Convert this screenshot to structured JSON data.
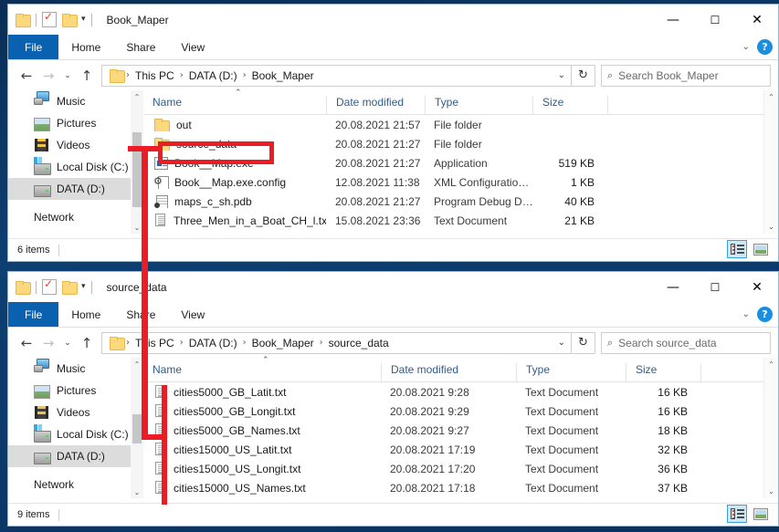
{
  "windows": [
    {
      "id": "window-book-maper",
      "title": "Book_Maper",
      "tabs": [
        "File",
        "Home",
        "Share",
        "View"
      ],
      "help_label": "?",
      "nav": {
        "back": "←",
        "forward": "→",
        "recent": "⌄",
        "up": "↑",
        "refresh": "↻",
        "crumbs": [
          "This PC",
          "DATA (D:)",
          "Book_Maper"
        ],
        "crumb_sep": "›",
        "dropdown_caret": "⌄",
        "search_placeholder": "Search Book_Maper",
        "search_icon": "⌕"
      },
      "sidebar": [
        {
          "label": "Music",
          "icon": "music-icon",
          "selected": false
        },
        {
          "label": "Pictures",
          "icon": "pictures-icon",
          "selected": false
        },
        {
          "label": "Videos",
          "icon": "videos-icon",
          "selected": false
        },
        {
          "label": "Local Disk (C:)",
          "icon": "drive-c-icon",
          "selected": false
        },
        {
          "label": "DATA (D:)",
          "icon": "drive-d-icon",
          "selected": true
        },
        {
          "label": "Network",
          "icon": "network-icon",
          "selected": false
        }
      ],
      "columns": [
        "Name",
        "Date modified",
        "Type",
        "Size"
      ],
      "sort_indicator": "⌃",
      "rows": [
        {
          "name": "out",
          "icon": "folder-icon",
          "date": "20.08.2021 21:57",
          "type": "File folder",
          "size": ""
        },
        {
          "name": "source_data",
          "icon": "folder-icon",
          "date": "20.08.2021 21:27",
          "type": "File folder",
          "size": ""
        },
        {
          "name": "Book__Map.exe",
          "icon": "exe-icon",
          "date": "20.08.2021 21:27",
          "type": "Application",
          "size": "519 KB"
        },
        {
          "name": "Book__Map.exe.config",
          "icon": "config-icon",
          "date": "12.08.2021 11:38",
          "type": "XML Configuratio…",
          "size": "1 KB"
        },
        {
          "name": "maps_c_sh.pdb",
          "icon": "pdb-icon",
          "date": "20.08.2021 21:27",
          "type": "Program Debug D…",
          "size": "40 KB"
        },
        {
          "name": "Three_Men_in_a_Boat_CH_l.txt",
          "icon": "text-icon",
          "date": "15.08.2021 23:36",
          "type": "Text Document",
          "size": "21 KB"
        }
      ],
      "status": {
        "count": "6 items"
      },
      "view_buttons": [
        "details-view",
        "large-icons-view"
      ],
      "controls": {
        "minimize": "—",
        "maximize": "☐",
        "close": "✕"
      }
    },
    {
      "id": "window-source-data",
      "title": "source_data",
      "tabs": [
        "File",
        "Home",
        "Share",
        "View"
      ],
      "help_label": "?",
      "nav": {
        "back": "←",
        "forward": "→",
        "recent": "⌄",
        "up": "↑",
        "refresh": "↻",
        "crumbs": [
          "This PC",
          "DATA (D:)",
          "Book_Maper",
          "source_data"
        ],
        "crumb_sep": "›",
        "dropdown_caret": "⌄",
        "search_placeholder": "Search source_data",
        "search_icon": "⌕"
      },
      "sidebar": [
        {
          "label": "Music",
          "icon": "music-icon",
          "selected": false
        },
        {
          "label": "Pictures",
          "icon": "pictures-icon",
          "selected": false
        },
        {
          "label": "Videos",
          "icon": "videos-icon",
          "selected": false
        },
        {
          "label": "Local Disk (C:)",
          "icon": "drive-c-icon",
          "selected": false
        },
        {
          "label": "DATA (D:)",
          "icon": "drive-d-icon",
          "selected": true
        },
        {
          "label": "Network",
          "icon": "network-icon",
          "selected": false
        }
      ],
      "columns": [
        "Name",
        "Date modified",
        "Type",
        "Size"
      ],
      "sort_indicator": "⌃",
      "rows": [
        {
          "name": "cities5000_GB_Latit.txt",
          "icon": "text-icon",
          "date": "20.08.2021 9:28",
          "type": "Text Document",
          "size": "16 KB"
        },
        {
          "name": "cities5000_GB_Longit.txt",
          "icon": "text-icon",
          "date": "20.08.2021 9:29",
          "type": "Text Document",
          "size": "16 KB"
        },
        {
          "name": "cities5000_GB_Names.txt",
          "icon": "text-icon",
          "date": "20.08.2021 9:27",
          "type": "Text Document",
          "size": "18 KB"
        },
        {
          "name": "cities15000_US_Latit.txt",
          "icon": "text-icon",
          "date": "20.08.2021 17:19",
          "type": "Text Document",
          "size": "32 KB"
        },
        {
          "name": "cities15000_US_Longit.txt",
          "icon": "text-icon",
          "date": "20.08.2021 17:20",
          "type": "Text Document",
          "size": "36 KB"
        },
        {
          "name": "cities15000_US_Names.txt",
          "icon": "text-icon",
          "date": "20.08.2021 17:18",
          "type": "Text Document",
          "size": "37 KB"
        }
      ],
      "status": {
        "count": "9 items"
      },
      "view_buttons": [
        "details-view",
        "large-icons-view"
      ],
      "controls": {
        "minimize": "—",
        "maximize": "☐",
        "close": "✕"
      }
    }
  ],
  "annotation": {
    "color": "#ec1c24",
    "description": "red highlight around source_data folder with connector line to the second window file list"
  },
  "quick_access": {
    "folder_icon": "folder-icon",
    "properties_icon": "properties-icon",
    "new_folder_icon": "new-folder-icon",
    "caret": "▾"
  }
}
